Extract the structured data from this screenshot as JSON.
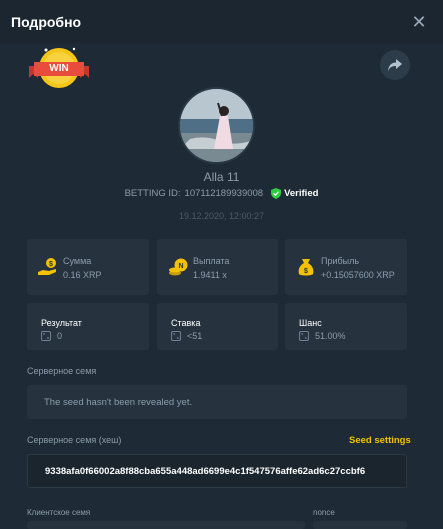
{
  "header": {
    "title": "Подробно",
    "close_icon": "close-icon"
  },
  "badge": {
    "text": "WIN"
  },
  "user": {
    "name": "Alla 11",
    "betting_id_label": "BETTING ID:",
    "betting_id": "107112189939008",
    "verified_label": "Verified",
    "timestamp": "19.12.2020, 12:00:27"
  },
  "stats": [
    {
      "icon": "hand-coin-icon",
      "label": "Сумма",
      "value": "0.16 XRP"
    },
    {
      "icon": "coin-stack-icon",
      "label": "Выплата",
      "value": "1.9411 x"
    },
    {
      "icon": "money-bag-icon",
      "label": "Прибыль",
      "value": "+0.15057600 XRP"
    }
  ],
  "details": [
    {
      "icon": "dice-icon",
      "label": "Результат",
      "value": "0"
    },
    {
      "icon": "dice-icon",
      "label": "Ставка",
      "value": "<51"
    },
    {
      "icon": "dice-icon",
      "label": "Шанс",
      "value": "51.00%"
    }
  ],
  "server_seed": {
    "label": "Серверное семя",
    "value": "The seed hasn't been revealed yet."
  },
  "server_seed_hash": {
    "label": "Серверное семя (хеш)",
    "settings_label": "Seed settings",
    "value": "9338afa0f66002a8f88cba655a448ad6699e4c1f547576affe62ad6c27ccbf6"
  },
  "client_seed": {
    "label": "Клиентское семя"
  },
  "nonce": {
    "label": "nonce"
  },
  "colors": {
    "accent": "#f2c200",
    "verified": "#2ecc40",
    "background": "#1e2a35",
    "card": "#26333f"
  }
}
